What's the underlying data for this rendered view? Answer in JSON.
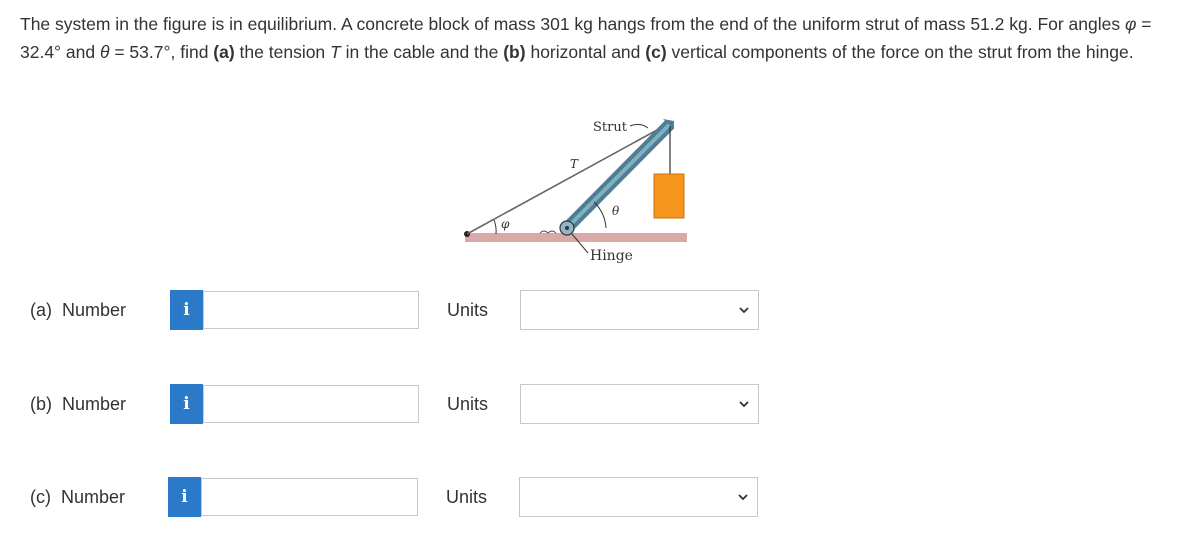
{
  "question": {
    "s1": "The system in the figure is in equilibrium. A concrete block of mass 301 kg hangs from the end of the uniform strut of mass 51.2 kg. For angles ",
    "phi_sym": "φ",
    "s2": " = 32.4° and ",
    "theta_sym": "θ",
    "s3": " = 53.7°, find ",
    "a_tag": "(a)",
    "s4": " the tension ",
    "T_sym": "T",
    "s5": " in the cable and the ",
    "b_tag": "(b)",
    "s6": " horizontal and ",
    "c_tag": "(c)",
    "s7": " vertical components of the force on the strut from the hinge."
  },
  "figure": {
    "strut_label": "Strut",
    "tension_label": "T",
    "theta_label": "θ",
    "phi_label": "φ",
    "hinge_label": "Hinge",
    "colors": {
      "floor": "#d9a9a9",
      "strut": "#5b8fa6",
      "block": "#f7941d",
      "cable": "#666666"
    }
  },
  "answers": [
    {
      "label": "(a)  Number",
      "info_icon": "i",
      "value": "",
      "units_label": "Units",
      "units_value": ""
    },
    {
      "label": "(b)  Number",
      "info_icon": "i",
      "value": "",
      "units_label": "Units",
      "units_value": ""
    },
    {
      "label": "(c)  Number",
      "info_icon": "i",
      "value": "",
      "units_label": "Units",
      "units_value": ""
    }
  ],
  "theme": {
    "info_button_color": "#2a7ac9"
  }
}
